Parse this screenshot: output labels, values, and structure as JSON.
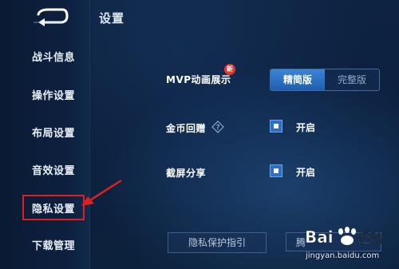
{
  "header": {
    "title": "设置"
  },
  "sidebar": {
    "items": [
      {
        "label": "战斗信息"
      },
      {
        "label": "操作设置"
      },
      {
        "label": "布局设置"
      },
      {
        "label": "音效设置"
      },
      {
        "label": "隐私设置"
      },
      {
        "label": "下载管理"
      }
    ],
    "active_index": 4,
    "back_icon": "back-arrow-icon"
  },
  "settings": {
    "mvp": {
      "label": "MVP动画展示",
      "badge": "新",
      "options": [
        "精简版",
        "完整版"
      ],
      "selected": "精简版"
    },
    "gold_gift": {
      "label": "金币回赠",
      "help_icon": "question-icon",
      "checked": true,
      "state_label": "开启"
    },
    "screenshot_share": {
      "label": "截屏分享",
      "checked": true,
      "state_label": "开启"
    }
  },
  "footer": {
    "buttons": [
      {
        "label": "隐私保护指引"
      },
      {
        "label": "腾"
      }
    ]
  },
  "watermark": {
    "logo_text": "Bai经验",
    "url": "jingyan.baidu.com"
  },
  "annotation": {
    "color": "#e02020"
  },
  "colors": {
    "accent": "#2d6fc4",
    "badge": "#e0362c"
  }
}
